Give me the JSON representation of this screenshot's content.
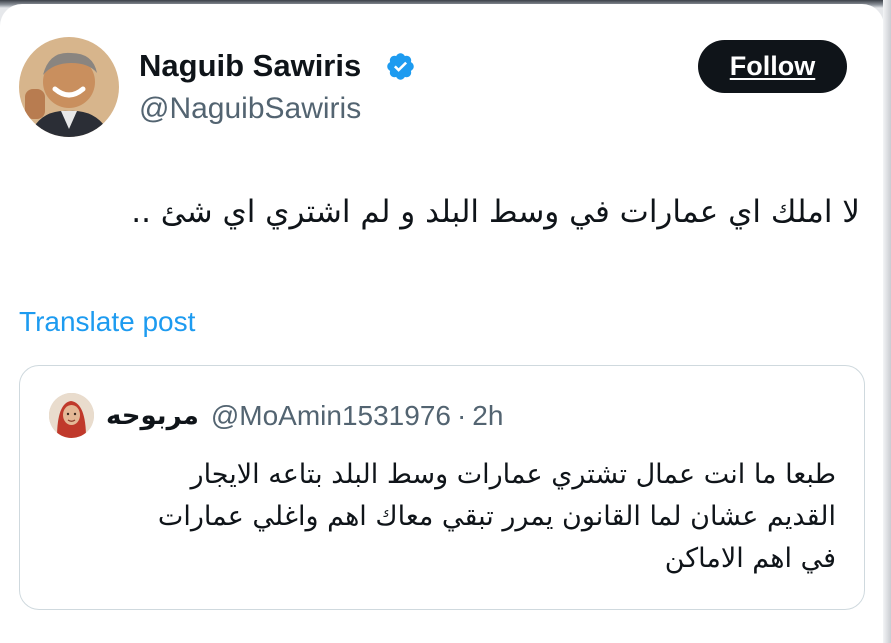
{
  "post": {
    "author": {
      "name": "Naguib Sawiris",
      "handle": "@NaguibSawiris",
      "verified": true
    },
    "follow_label": "Follow",
    "text": "لا املك اي عمارات في وسط البلد و لم اشتري اي شئ ..",
    "translate_label": "Translate post"
  },
  "quote": {
    "name": "مربوحه",
    "handle": "@MoAmin1531976",
    "separator": "·",
    "time": "2h",
    "lines": [
      "طبعا ما انت عمال تشتري عمارات وسط البلد بتاعه الايجار",
      "القديم عشان لما القانون يمرر تبقي معاك اهم واغلي عمارات",
      "في اهم الاماكن"
    ]
  },
  "colors": {
    "text": "#0f1419",
    "secondary": "#536471",
    "link": "#1d9bf0",
    "verified": "#1d9bf0",
    "button_bg": "#0f1419",
    "border": "#cfd9de"
  },
  "icons": {
    "verified": "verified-badge-icon"
  }
}
